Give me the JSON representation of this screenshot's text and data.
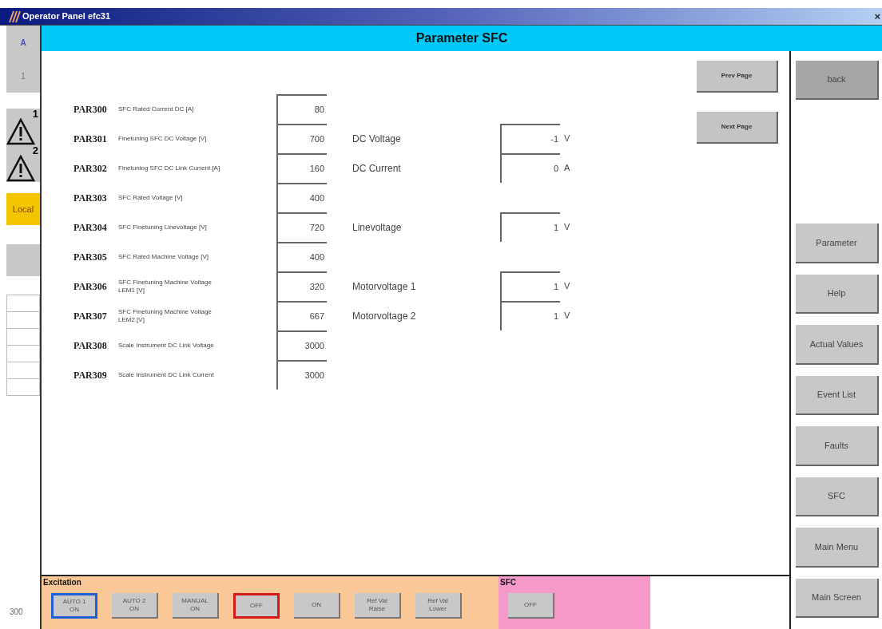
{
  "window": {
    "title": "Operator Panel efc31",
    "close": "×"
  },
  "header": {
    "title": "Parameter SFC"
  },
  "left_panel": {
    "cells": [
      "A",
      "1"
    ],
    "warnings": [
      "1",
      "2"
    ],
    "mode": "Local",
    "footer": "300"
  },
  "page_buttons": [
    "Prev Page",
    "Next Page"
  ],
  "parameters": [
    {
      "code": "PAR300",
      "description": "SFC Rated Current DC [A]",
      "value": "80"
    },
    {
      "code": "PAR301",
      "description": "Finetuning SFC DC Voltage [V]",
      "value": "700",
      "reading": {
        "label": "DC Voltage",
        "value": "-1",
        "unit": "V"
      }
    },
    {
      "code": "PAR302",
      "description": "Finetuning SFC DC Link Current [A]",
      "value": "160",
      "reading": {
        "label": "DC Current",
        "value": "0",
        "unit": "A"
      }
    },
    {
      "code": "PAR303",
      "description": "SFC Rated Voltage [V]",
      "value": "400"
    },
    {
      "code": "PAR304",
      "description": "SFC Finetuning Linevoltage [V]",
      "value": "720",
      "reading": {
        "label": "Linevoltage",
        "value": "1",
        "unit": "V"
      }
    },
    {
      "code": "PAR305",
      "description": "SFC Rated Machine Voltage [V]",
      "value": "400"
    },
    {
      "code": "PAR306",
      "description": "SFC Finetuning Machine Voltage LEM1 [V]",
      "value": "320",
      "reading": {
        "label": "Motorvoltage 1",
        "value": "1",
        "unit": "V"
      }
    },
    {
      "code": "PAR307",
      "description": "SFC Finetuning Machine Voltage LEM2 [V]",
      "value": "667",
      "reading": {
        "label": "Motorvoltage 2",
        "value": "1",
        "unit": "V"
      }
    },
    {
      "code": "PAR308",
      "description": "Scale Instrument DC Link Voltage",
      "value": "3000"
    },
    {
      "code": "PAR309",
      "description": "Scale Instrument DC Link Current",
      "value": "3000"
    }
  ],
  "nav": [
    {
      "label": "back",
      "kind": "back"
    },
    {
      "label": "Parameter",
      "kind": "nav"
    },
    {
      "label": "Help",
      "kind": "nav"
    },
    {
      "label": "Actual Values",
      "kind": "nav"
    },
    {
      "label": "Event List",
      "kind": "nav"
    },
    {
      "label": "Faults",
      "kind": "nav"
    },
    {
      "label": "SFC",
      "kind": "nav"
    },
    {
      "label": "Main Menu",
      "kind": "nav"
    },
    {
      "label": "Main Screen",
      "kind": "nav"
    }
  ],
  "control_bar": {
    "excitation": {
      "title": "Excitation",
      "buttons": [
        {
          "label": [
            "AUTO 1",
            "ON"
          ],
          "color": "#1f5fd6"
        },
        {
          "label": [
            "AUTO 2",
            "ON"
          ]
        },
        {
          "label": [
            "MANUAL",
            "ON"
          ]
        },
        {
          "label": [
            "OFF"
          ],
          "color": "#d21a1a"
        },
        {
          "label": [
            "ON"
          ]
        },
        {
          "label": [
            "Ref Val",
            "Raise"
          ]
        },
        {
          "label": [
            "Ref Val",
            "Lower"
          ]
        }
      ]
    },
    "sfc": {
      "title": "SFC",
      "buttons": [
        {
          "label": [
            "OFF"
          ]
        }
      ]
    }
  }
}
